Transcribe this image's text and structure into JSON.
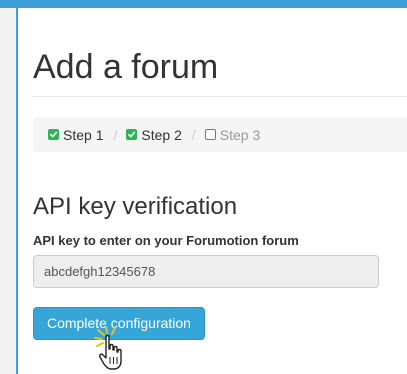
{
  "page": {
    "title": "Add a forum"
  },
  "steps": [
    {
      "label": "Step 1",
      "state": "complete",
      "icon": "check-square-icon"
    },
    {
      "label": "Step 2",
      "state": "complete",
      "icon": "check-square-icon"
    },
    {
      "label": "Step 3",
      "state": "pending",
      "icon": "empty-square-icon"
    }
  ],
  "steps_separator": "/",
  "section": {
    "title": "API key verification",
    "field_label": "API key to enter on your Forumotion forum",
    "field_value": "abcdefgh12345678"
  },
  "actions": {
    "complete_label": "Complete configuration"
  },
  "colors": {
    "accent": "#3a9fd5",
    "button": "#38a5d8",
    "check": "#2fb459"
  }
}
